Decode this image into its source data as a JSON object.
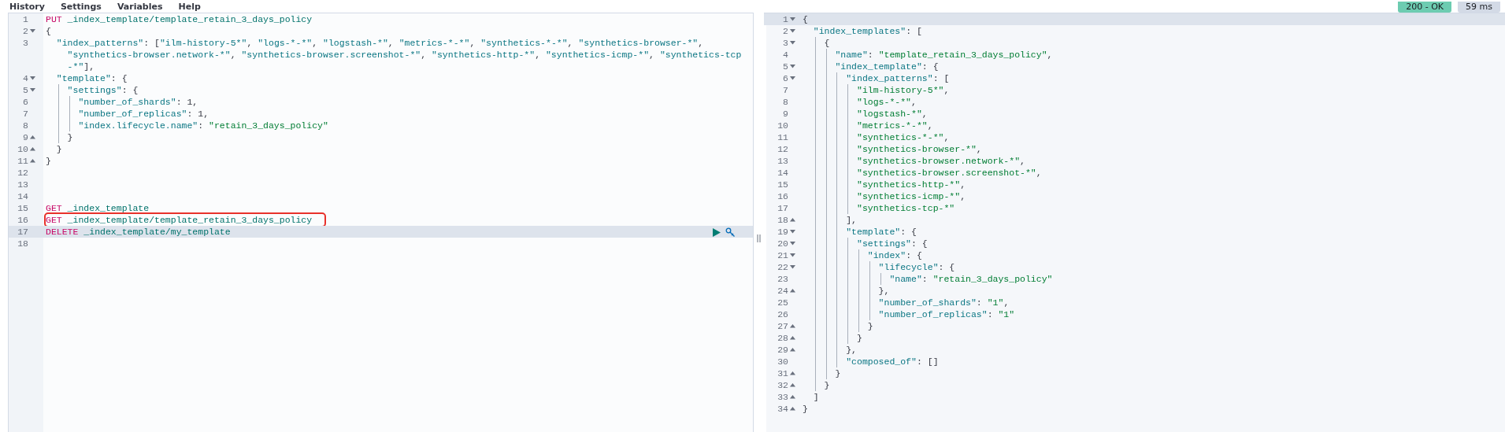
{
  "menu": [
    {
      "label": "History"
    },
    {
      "label": "Settings"
    },
    {
      "label": "Variables"
    },
    {
      "label": "Help"
    }
  ],
  "status": {
    "code": "200 - OK",
    "time": "59 ms"
  },
  "request_editor": {
    "lines": [
      {
        "number": "1",
        "fold_start": false,
        "fold_end": false,
        "active": false,
        "highlighted": false,
        "wraps": [
          {
            "tokens": [
              {
                "kind": "method",
                "text": "PUT"
              },
              {
                "kind": "path",
                "text": " _index_template/template_retain_3_days_policy"
              }
            ]
          }
        ]
      },
      {
        "number": "2",
        "fold_start": true,
        "fold_end": false,
        "active": false,
        "highlighted": false,
        "wraps": [
          {
            "tokens": [
              {
                "kind": "punct",
                "text": "{"
              }
            ]
          }
        ]
      },
      {
        "number": "3",
        "fold_start": false,
        "fold_end": false,
        "active": false,
        "highlighted": false,
        "wraps": [
          {
            "tokens": [
              {
                "kind": "key",
                "text": "  \"index_patterns\""
              },
              {
                "kind": "punct",
                "text": ": ["
              },
              {
                "kind": "literal",
                "text": "\"ilm-history-5*\""
              },
              {
                "kind": "punct",
                "text": ", "
              },
              {
                "kind": "literal",
                "text": "\"logs-*-*\""
              },
              {
                "kind": "punct",
                "text": ", "
              },
              {
                "kind": "literal",
                "text": "\"logstash-*\""
              },
              {
                "kind": "punct",
                "text": ", "
              },
              {
                "kind": "literal",
                "text": "\"metrics-*-*\""
              },
              {
                "kind": "punct",
                "text": ", "
              },
              {
                "kind": "literal",
                "text": "\"synthetics-*-*\""
              },
              {
                "kind": "punct",
                "text": ", "
              },
              {
                "kind": "literal",
                "text": "\"synthetics-browser-*\""
              },
              {
                "kind": "punct",
                "text": ","
              }
            ]
          },
          {
            "tokens": [
              {
                "kind": "literal",
                "text": "    \"synthetics-browser.network-*\""
              },
              {
                "kind": "punct",
                "text": ", "
              },
              {
                "kind": "literal",
                "text": "\"synthetics-browser.screenshot-*\""
              },
              {
                "kind": "punct",
                "text": ", "
              },
              {
                "kind": "literal",
                "text": "\"synthetics-http-*\""
              },
              {
                "kind": "punct",
                "text": ", "
              },
              {
                "kind": "literal",
                "text": "\"synthetics-icmp-*\""
              },
              {
                "kind": "punct",
                "text": ", "
              },
              {
                "kind": "literal",
                "text": "\"synthetics-tcp"
              }
            ]
          },
          {
            "tokens": [
              {
                "kind": "literal",
                "text": "    -*\""
              },
              {
                "kind": "punct",
                "text": "],"
              }
            ]
          }
        ]
      },
      {
        "number": "4",
        "fold_start": true,
        "fold_end": false,
        "active": false,
        "highlighted": false,
        "wraps": [
          {
            "tokens": [
              {
                "kind": "key",
                "text": "  \"template\""
              },
              {
                "kind": "punct",
                "text": ": {"
              }
            ]
          }
        ]
      },
      {
        "number": "5",
        "fold_start": true,
        "fold_end": false,
        "active": false,
        "highlighted": false,
        "wraps": [
          {
            "tokens": [
              {
                "kind": "key",
                "text": "    \"settings\""
              },
              {
                "kind": "punct",
                "text": ": {"
              }
            ]
          }
        ]
      },
      {
        "number": "6",
        "fold_start": false,
        "fold_end": false,
        "active": false,
        "highlighted": false,
        "wraps": [
          {
            "tokens": [
              {
                "kind": "key",
                "text": "      \"number_of_shards\""
              },
              {
                "kind": "punct",
                "text": ": "
              },
              {
                "kind": "number",
                "text": "1"
              },
              {
                "kind": "punct",
                "text": ","
              }
            ]
          }
        ]
      },
      {
        "number": "7",
        "fold_start": false,
        "fold_end": false,
        "active": false,
        "highlighted": false,
        "wraps": [
          {
            "tokens": [
              {
                "kind": "key",
                "text": "      \"number_of_replicas\""
              },
              {
                "kind": "punct",
                "text": ": "
              },
              {
                "kind": "number",
                "text": "1"
              },
              {
                "kind": "punct",
                "text": ","
              }
            ]
          }
        ]
      },
      {
        "number": "8",
        "fold_start": false,
        "fold_end": false,
        "active": false,
        "highlighted": false,
        "wraps": [
          {
            "tokens": [
              {
                "kind": "key",
                "text": "      \"index.lifecycle.name\""
              },
              {
                "kind": "punct",
                "text": ": "
              },
              {
                "kind": "string",
                "text": "\"retain_3_days_policy\""
              }
            ]
          }
        ]
      },
      {
        "number": "9",
        "fold_start": false,
        "fold_end": true,
        "active": false,
        "highlighted": false,
        "wraps": [
          {
            "tokens": [
              {
                "kind": "punct",
                "text": "    }"
              }
            ]
          }
        ]
      },
      {
        "number": "10",
        "fold_start": false,
        "fold_end": true,
        "active": false,
        "highlighted": false,
        "wraps": [
          {
            "tokens": [
              {
                "kind": "punct",
                "text": "  }"
              }
            ]
          }
        ]
      },
      {
        "number": "11",
        "fold_start": false,
        "fold_end": true,
        "active": false,
        "highlighted": false,
        "wraps": [
          {
            "tokens": [
              {
                "kind": "punct",
                "text": "}"
              }
            ]
          }
        ]
      },
      {
        "number": "12",
        "fold_start": false,
        "fold_end": false,
        "active": false,
        "highlighted": false
      },
      {
        "number": "13",
        "fold_start": false,
        "fold_end": false,
        "active": false,
        "highlighted": false
      },
      {
        "number": "14",
        "fold_start": false,
        "fold_end": false,
        "active": false,
        "highlighted": false
      },
      {
        "number": "15",
        "fold_start": false,
        "fold_end": false,
        "active": false,
        "highlighted": false,
        "wraps": [
          {
            "tokens": [
              {
                "kind": "method",
                "text": "GET"
              },
              {
                "kind": "path",
                "text": " _index_template"
              }
            ]
          }
        ]
      },
      {
        "number": "16",
        "fold_start": false,
        "fold_end": false,
        "active": false,
        "highlighted": true,
        "wraps": [
          {
            "tokens": [
              {
                "kind": "method",
                "text": "GET"
              },
              {
                "kind": "path",
                "text": " _index_template/template_retain_3_days_policy"
              }
            ]
          }
        ]
      },
      {
        "number": "17",
        "fold_start": false,
        "fold_end": false,
        "active": true,
        "highlighted": false,
        "wraps": [
          {
            "tokens": [
              {
                "kind": "method",
                "text": "DELETE"
              },
              {
                "kind": "path",
                "text": " _index_template/my_template"
              }
            ]
          }
        ]
      },
      {
        "number": "18",
        "fold_start": false,
        "fold_end": false,
        "active": false,
        "highlighted": false
      }
    ]
  },
  "response_editor": {
    "lines": [
      {
        "number": "1",
        "fold_start": true,
        "fold_end": false,
        "active": true,
        "wraps": [
          {
            "tokens": [
              {
                "kind": "punct",
                "text": "{"
              }
            ]
          }
        ]
      },
      {
        "number": "2",
        "fold_start": true,
        "fold_end": false,
        "active": false,
        "wraps": [
          {
            "tokens": [
              {
                "kind": "key",
                "text": "  \"index_templates\""
              },
              {
                "kind": "punct",
                "text": ": ["
              }
            ]
          }
        ]
      },
      {
        "number": "3",
        "fold_start": true,
        "fold_end": false,
        "active": false,
        "wraps": [
          {
            "tokens": [
              {
                "kind": "punct",
                "text": "    {"
              }
            ]
          }
        ]
      },
      {
        "number": "4",
        "fold_start": false,
        "fold_end": false,
        "active": false,
        "wraps": [
          {
            "tokens": [
              {
                "kind": "key",
                "text": "      \"name\""
              },
              {
                "kind": "punct",
                "text": ": "
              },
              {
                "kind": "string",
                "text": "\"template_retain_3_days_policy\""
              },
              {
                "kind": "punct",
                "text": ","
              }
            ]
          }
        ]
      },
      {
        "number": "5",
        "fold_start": true,
        "fold_end": false,
        "active": false,
        "wraps": [
          {
            "tokens": [
              {
                "kind": "key",
                "text": "      \"index_template\""
              },
              {
                "kind": "punct",
                "text": ": {"
              }
            ]
          }
        ]
      },
      {
        "number": "6",
        "fold_start": true,
        "fold_end": false,
        "active": false,
        "wraps": [
          {
            "tokens": [
              {
                "kind": "key",
                "text": "        \"index_patterns\""
              },
              {
                "kind": "punct",
                "text": ": ["
              }
            ]
          }
        ]
      },
      {
        "number": "7",
        "fold_start": false,
        "fold_end": false,
        "active": false,
        "wraps": [
          {
            "tokens": [
              {
                "kind": "string",
                "text": "          \"ilm-history-5*\""
              },
              {
                "kind": "punct",
                "text": ","
              }
            ]
          }
        ]
      },
      {
        "number": "8",
        "fold_start": false,
        "fold_end": false,
        "active": false,
        "wraps": [
          {
            "tokens": [
              {
                "kind": "string",
                "text": "          \"logs-*-*\""
              },
              {
                "kind": "punct",
                "text": ","
              }
            ]
          }
        ]
      },
      {
        "number": "9",
        "fold_start": false,
        "fold_end": false,
        "active": false,
        "wraps": [
          {
            "tokens": [
              {
                "kind": "string",
                "text": "          \"logstash-*\""
              },
              {
                "kind": "punct",
                "text": ","
              }
            ]
          }
        ]
      },
      {
        "number": "10",
        "fold_start": false,
        "fold_end": false,
        "active": false,
        "wraps": [
          {
            "tokens": [
              {
                "kind": "string",
                "text": "          \"metrics-*-*\""
              },
              {
                "kind": "punct",
                "text": ","
              }
            ]
          }
        ]
      },
      {
        "number": "11",
        "fold_start": false,
        "fold_end": false,
        "active": false,
        "wraps": [
          {
            "tokens": [
              {
                "kind": "string",
                "text": "          \"synthetics-*-*\""
              },
              {
                "kind": "punct",
                "text": ","
              }
            ]
          }
        ]
      },
      {
        "number": "12",
        "fold_start": false,
        "fold_end": false,
        "active": false,
        "wraps": [
          {
            "tokens": [
              {
                "kind": "string",
                "text": "          \"synthetics-browser-*\""
              },
              {
                "kind": "punct",
                "text": ","
              }
            ]
          }
        ]
      },
      {
        "number": "13",
        "fold_start": false,
        "fold_end": false,
        "active": false,
        "wraps": [
          {
            "tokens": [
              {
                "kind": "string",
                "text": "          \"synthetics-browser.network-*\""
              },
              {
                "kind": "punct",
                "text": ","
              }
            ]
          }
        ]
      },
      {
        "number": "14",
        "fold_start": false,
        "fold_end": false,
        "active": false,
        "wraps": [
          {
            "tokens": [
              {
                "kind": "string",
                "text": "          \"synthetics-browser.screenshot-*\""
              },
              {
                "kind": "punct",
                "text": ","
              }
            ]
          }
        ]
      },
      {
        "number": "15",
        "fold_start": false,
        "fold_end": false,
        "active": false,
        "wraps": [
          {
            "tokens": [
              {
                "kind": "string",
                "text": "          \"synthetics-http-*\""
              },
              {
                "kind": "punct",
                "text": ","
              }
            ]
          }
        ]
      },
      {
        "number": "16",
        "fold_start": false,
        "fold_end": false,
        "active": false,
        "wraps": [
          {
            "tokens": [
              {
                "kind": "string",
                "text": "          \"synthetics-icmp-*\""
              },
              {
                "kind": "punct",
                "text": ","
              }
            ]
          }
        ]
      },
      {
        "number": "17",
        "fold_start": false,
        "fold_end": false,
        "active": false,
        "wraps": [
          {
            "tokens": [
              {
                "kind": "string",
                "text": "          \"synthetics-tcp-*\""
              }
            ]
          }
        ]
      },
      {
        "number": "18",
        "fold_start": false,
        "fold_end": true,
        "active": false,
        "wraps": [
          {
            "tokens": [
              {
                "kind": "punct",
                "text": "        ],"
              }
            ]
          }
        ]
      },
      {
        "number": "19",
        "fold_start": true,
        "fold_end": false,
        "active": false,
        "wraps": [
          {
            "tokens": [
              {
                "kind": "key",
                "text": "        \"template\""
              },
              {
                "kind": "punct",
                "text": ": {"
              }
            ]
          }
        ]
      },
      {
        "number": "20",
        "fold_start": true,
        "fold_end": false,
        "active": false,
        "wraps": [
          {
            "tokens": [
              {
                "kind": "key",
                "text": "          \"settings\""
              },
              {
                "kind": "punct",
                "text": ": {"
              }
            ]
          }
        ]
      },
      {
        "number": "21",
        "fold_start": true,
        "fold_end": false,
        "active": false,
        "wraps": [
          {
            "tokens": [
              {
                "kind": "key",
                "text": "            \"index\""
              },
              {
                "kind": "punct",
                "text": ": {"
              }
            ]
          }
        ]
      },
      {
        "number": "22",
        "fold_start": true,
        "fold_end": false,
        "active": false,
        "wraps": [
          {
            "tokens": [
              {
                "kind": "key",
                "text": "              \"lifecycle\""
              },
              {
                "kind": "punct",
                "text": ": {"
              }
            ]
          }
        ]
      },
      {
        "number": "23",
        "fold_start": false,
        "fold_end": false,
        "active": false,
        "wraps": [
          {
            "tokens": [
              {
                "kind": "key",
                "text": "                \"name\""
              },
              {
                "kind": "punct",
                "text": ": "
              },
              {
                "kind": "string",
                "text": "\"retain_3_days_policy\""
              }
            ]
          }
        ]
      },
      {
        "number": "24",
        "fold_start": false,
        "fold_end": true,
        "active": false,
        "wraps": [
          {
            "tokens": [
              {
                "kind": "punct",
                "text": "              },"
              }
            ]
          }
        ]
      },
      {
        "number": "25",
        "fold_start": false,
        "fold_end": false,
        "active": false,
        "wraps": [
          {
            "tokens": [
              {
                "kind": "key",
                "text": "              \"number_of_shards\""
              },
              {
                "kind": "punct",
                "text": ": "
              },
              {
                "kind": "string",
                "text": "\"1\""
              },
              {
                "kind": "punct",
                "text": ","
              }
            ]
          }
        ]
      },
      {
        "number": "26",
        "fold_start": false,
        "fold_end": false,
        "active": false,
        "wraps": [
          {
            "tokens": [
              {
                "kind": "key",
                "text": "              \"number_of_replicas\""
              },
              {
                "kind": "punct",
                "text": ": "
              },
              {
                "kind": "string",
                "text": "\"1\""
              }
            ]
          }
        ]
      },
      {
        "number": "27",
        "fold_start": false,
        "fold_end": true,
        "active": false,
        "wraps": [
          {
            "tokens": [
              {
                "kind": "punct",
                "text": "            }"
              }
            ]
          }
        ]
      },
      {
        "number": "28",
        "fold_start": false,
        "fold_end": true,
        "active": false,
        "wraps": [
          {
            "tokens": [
              {
                "kind": "punct",
                "text": "          }"
              }
            ]
          }
        ]
      },
      {
        "number": "29",
        "fold_start": false,
        "fold_end": true,
        "active": false,
        "wraps": [
          {
            "tokens": [
              {
                "kind": "punct",
                "text": "        },"
              }
            ]
          }
        ]
      },
      {
        "number": "30",
        "fold_start": false,
        "fold_end": false,
        "active": false,
        "wraps": [
          {
            "tokens": [
              {
                "kind": "key",
                "text": "        \"composed_of\""
              },
              {
                "kind": "punct",
                "text": ": []"
              }
            ]
          }
        ]
      },
      {
        "number": "31",
        "fold_start": false,
        "fold_end": true,
        "active": false,
        "wraps": [
          {
            "tokens": [
              {
                "kind": "punct",
                "text": "      }"
              }
            ]
          }
        ]
      },
      {
        "number": "32",
        "fold_start": false,
        "fold_end": true,
        "active": false,
        "wraps": [
          {
            "tokens": [
              {
                "kind": "punct",
                "text": "    }"
              }
            ]
          }
        ]
      },
      {
        "number": "33",
        "fold_start": false,
        "fold_end": true,
        "active": false,
        "wraps": [
          {
            "tokens": [
              {
                "kind": "punct",
                "text": "  ]"
              }
            ]
          }
        ]
      },
      {
        "number": "34",
        "fold_start": false,
        "fold_end": true,
        "active": false,
        "wraps": [
          {
            "tokens": [
              {
                "kind": "punct",
                "text": "}"
              }
            ]
          }
        ]
      }
    ]
  }
}
